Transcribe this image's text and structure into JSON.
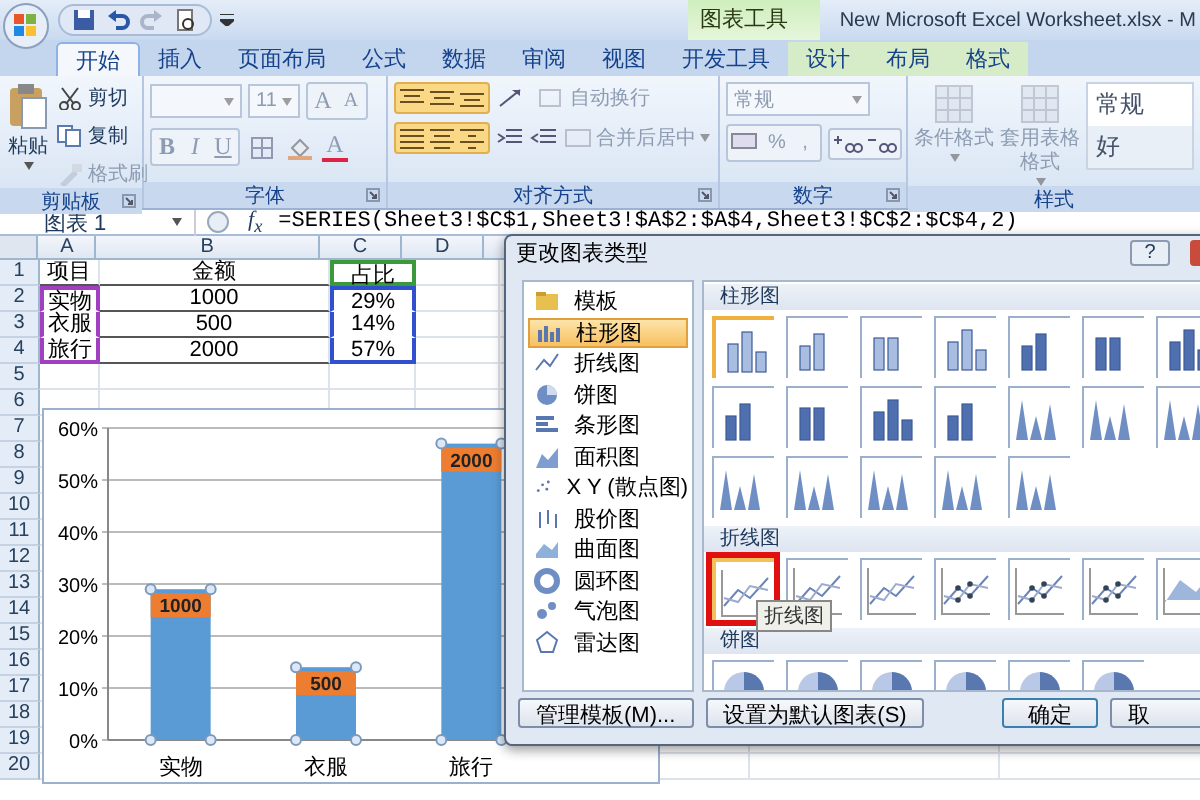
{
  "title_bar": {
    "context_tab": "图表工具",
    "title": "New Microsoft Excel Worksheet.xlsx - M"
  },
  "tabs": [
    {
      "label": "开始",
      "selected": true,
      "kind": "main"
    },
    {
      "label": "插入",
      "selected": false,
      "kind": "main"
    },
    {
      "label": "页面布局",
      "selected": false,
      "kind": "main"
    },
    {
      "label": "公式",
      "selected": false,
      "kind": "main"
    },
    {
      "label": "数据",
      "selected": false,
      "kind": "main"
    },
    {
      "label": "审阅",
      "selected": false,
      "kind": "main"
    },
    {
      "label": "视图",
      "selected": false,
      "kind": "main"
    },
    {
      "label": "开发工具",
      "selected": false,
      "kind": "main"
    },
    {
      "label": "设计",
      "selected": false,
      "kind": "context"
    },
    {
      "label": "布局",
      "selected": false,
      "kind": "context"
    },
    {
      "label": "格式",
      "selected": false,
      "kind": "context"
    }
  ],
  "ribbon": {
    "groups": [
      {
        "kind": "clipboard",
        "label": "剪贴板",
        "launcher": true,
        "paste": {
          "label": "粘贴",
          "disabled": false
        },
        "items": [
          {
            "label": "剪切",
            "disabled": false
          },
          {
            "label": "复制",
            "disabled": false
          },
          {
            "label": "格式刷",
            "disabled": true
          }
        ]
      },
      {
        "kind": "font",
        "label": "字体",
        "launcher": true,
        "disabled": true,
        "font_size": "11",
        "size_buttons": [
          "A",
          "A"
        ],
        "format_buttons": [
          "B",
          "I",
          "U"
        ],
        "color_button": "A"
      },
      {
        "kind": "alignment",
        "label": "对齐方式",
        "launcher": true,
        "items": [
          {
            "label": "自动换行",
            "disabled": true
          },
          {
            "label": "合并后居中",
            "disabled": true
          }
        ]
      },
      {
        "kind": "number",
        "label": "数字",
        "launcher": true,
        "disabled": true,
        "format": "常规",
        "symbols": [
          "%",
          ","
        ]
      },
      {
        "kind": "styles",
        "label": "样式",
        "launcher": false,
        "buttons": [
          {
            "label": "条件格式",
            "disabled": true
          },
          {
            "label": "套用表格格式",
            "disabled": true
          }
        ],
        "gallery": [
          "常规",
          "好"
        ]
      }
    ]
  },
  "formula_bar": {
    "name_box": "图表 1",
    "fx": "f$_{x}$",
    "formula": "=SERIES(Sheet3!$C$1,Sheet3!$A$2:$A$4,Sheet3!$C$2:$C$4,2)"
  },
  "sheet": {
    "columns": [
      "A",
      "B",
      "C",
      "D"
    ],
    "rows": [
      {
        "num": "1",
        "cells": [
          {
            "text": "项目"
          },
          {
            "text": "金额"
          },
          {
            "text": "占比",
            "color": "#3a9a3a"
          }
        ]
      },
      {
        "num": "2",
        "cells": [
          {
            "text": "实物",
            "color": "#a040c0"
          },
          {
            "text": "1000"
          },
          {
            "text": "29%",
            "color": "#3050d0"
          }
        ]
      },
      {
        "num": "3",
        "cells": [
          {
            "text": "衣服",
            "color": "#a040c0"
          },
          {
            "text": "500"
          },
          {
            "text": "14%",
            "color": "#3050d0"
          }
        ]
      },
      {
        "num": "4",
        "cells": [
          {
            "text": "旅行",
            "color": "#a040c0"
          },
          {
            "text": "2000"
          },
          {
            "text": "57%",
            "color": "#3050d0"
          }
        ]
      },
      {
        "num": "5"
      },
      {
        "num": "6"
      },
      {
        "num": "7"
      },
      {
        "num": "8"
      },
      {
        "num": "9"
      },
      {
        "num": "10"
      },
      {
        "num": "11"
      },
      {
        "num": "12"
      },
      {
        "num": "13"
      },
      {
        "num": "14"
      },
      {
        "num": "15"
      },
      {
        "num": "16"
      },
      {
        "num": "17"
      },
      {
        "num": "18"
      },
      {
        "num": "19"
      },
      {
        "num": "20"
      }
    ],
    "chart": {
      "chart_data": {
        "type": "bar",
        "categories": [
          "实物",
          "衣服",
          "旅行"
        ],
        "ylim": [
          0,
          60
        ],
        "grid": true,
        "yticks": [
          {
            "value": 0,
            "label": "0%"
          },
          {
            "value": 10,
            "label": "10%"
          },
          {
            "value": 20,
            "label": "20%"
          },
          {
            "value": 30,
            "label": "30%"
          },
          {
            "value": 40,
            "label": "40%"
          },
          {
            "value": 50,
            "label": "50%"
          },
          {
            "value": 60,
            "label": "60%"
          }
        ],
        "series": [
          {
            "color": "#5b9bd5",
            "values": [
              29,
              14,
              57
            ]
          }
        ],
        "annotations": [
          {
            "x": "实物",
            "y": 29,
            "text": "1000"
          },
          {
            "x": "衣服",
            "y": 14,
            "text": "500"
          },
          {
            "x": "旅行",
            "y": 57,
            "text": "2000"
          }
        ]
      }
    }
  },
  "dialog": {
    "title": "更改图表类型",
    "help": "?",
    "types": [
      {
        "label": "模板",
        "selected": false
      },
      {
        "label": "柱形图",
        "selected": true
      },
      {
        "label": "折线图",
        "selected": false
      },
      {
        "label": "饼图",
        "selected": false
      },
      {
        "label": "条形图",
        "selected": false
      },
      {
        "label": "面积图",
        "selected": false
      },
      {
        "label": "X Y (散点图)",
        "selected": false
      },
      {
        "label": "股价图",
        "selected": false
      },
      {
        "label": "曲面图",
        "selected": false
      },
      {
        "label": "圆环图",
        "selected": false
      },
      {
        "label": "气泡图",
        "selected": false
      },
      {
        "label": "雷达图",
        "selected": false
      }
    ],
    "sections": [
      {
        "title": "柱形图",
        "kind": "column",
        "thumbs": [
          {
            "selected": true,
            "highlighted": false
          },
          {
            "selected": false,
            "highlighted": false
          },
          {
            "selected": false,
            "highlighted": false
          },
          {
            "selected": false,
            "highlighted": false
          },
          {
            "selected": false,
            "highlighted": false
          },
          {
            "selected": false,
            "highlighted": false
          },
          {
            "selected": false,
            "highlighted": false
          },
          {
            "selected": false,
            "highlighted": false
          },
          {
            "selected": false,
            "highlighted": false
          },
          {
            "selected": false,
            "highlighted": false
          },
          {
            "selected": false,
            "highlighted": false
          },
          {
            "selected": false,
            "highlighted": false
          },
          {
            "selected": false,
            "highlighted": false
          },
          {
            "selected": false,
            "highlighted": false
          },
          {
            "selected": false,
            "highlighted": false
          },
          {
            "selected": false,
            "highlighted": false
          },
          {
            "selected": false,
            "highlighted": false
          },
          {
            "selected": false,
            "highlighted": false
          },
          {
            "selected": false,
            "highlighted": false
          }
        ]
      },
      {
        "title": "折线图",
        "kind": "line",
        "tooltip": "折线图",
        "thumbs": [
          {
            "selected": false,
            "highlighted": true
          },
          {
            "selected": false,
            "highlighted": false
          },
          {
            "selected": false,
            "highlighted": false
          },
          {
            "selected": false,
            "highlighted": false
          },
          {
            "selected": false,
            "highlighted": false
          },
          {
            "selected": false,
            "highlighted": false
          },
          {
            "selected": false,
            "highlighted": false
          }
        ]
      },
      {
        "title": "饼图",
        "kind": "pie",
        "thumbs": [
          {
            "selected": false,
            "highlighted": false
          },
          {
            "selected": false,
            "highlighted": false
          },
          {
            "selected": false,
            "highlighted": false
          },
          {
            "selected": false,
            "highlighted": false
          },
          {
            "selected": false,
            "highlighted": false
          },
          {
            "selected": false,
            "highlighted": false
          }
        ]
      }
    ],
    "buttons": [
      {
        "label": "管理模板(M)...",
        "kind": "left"
      },
      {
        "label": "设置为默认图表(S)",
        "kind": "left"
      },
      {
        "label": "确定",
        "kind": "default"
      },
      {
        "label": "取",
        "kind": "right"
      }
    ]
  }
}
